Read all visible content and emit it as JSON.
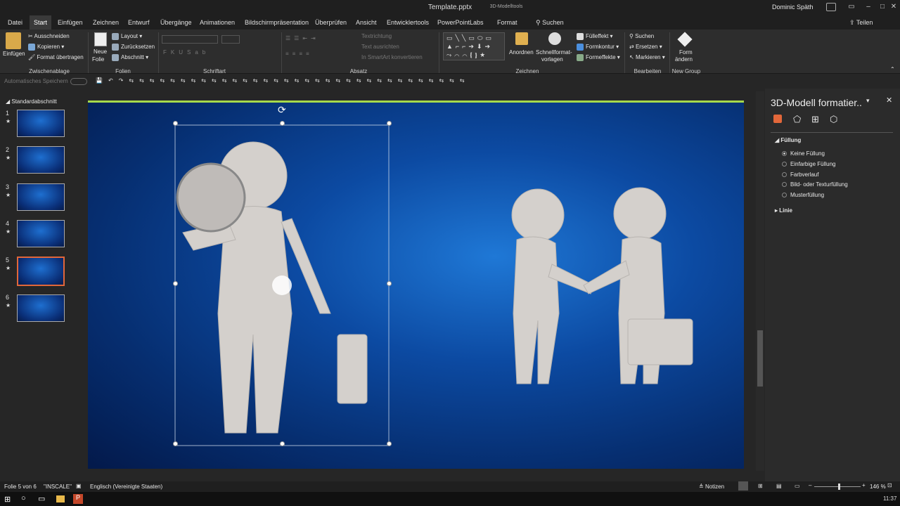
{
  "titlebar": {
    "document": "Template.pptx",
    "context_tab": "3D-Modelltools",
    "user": "Dominic Späth"
  },
  "tabs": [
    {
      "label": "Datei"
    },
    {
      "label": "Start"
    },
    {
      "label": "Einfügen"
    },
    {
      "label": "Zeichnen"
    },
    {
      "label": "Entwurf"
    },
    {
      "label": "Übergänge"
    },
    {
      "label": "Animationen"
    },
    {
      "label": "Bildschirmpräsentation"
    },
    {
      "label": "Überprüfen"
    },
    {
      "label": "Ansicht"
    },
    {
      "label": "Entwicklertools"
    },
    {
      "label": "PowerPointLabs"
    },
    {
      "label": "Format"
    }
  ],
  "search_label": "Suchen",
  "share_label": "Teilen",
  "ribbon": {
    "clipboard": {
      "paste": "Einfügen",
      "cut": "Ausschneiden",
      "copy": "Kopieren",
      "format_painter": "Format übertragen",
      "group": "Zwischenablage"
    },
    "slides": {
      "new_slide_1": "Neue",
      "new_slide_2": "Folie",
      "layout": "Layout",
      "reset": "Zurücksetzen",
      "section": "Abschnitt",
      "group": "Folien"
    },
    "font": {
      "group": "Schriftart"
    },
    "paragraph": {
      "text_direction": "Textrichtung",
      "align_text": "Text ausrichten",
      "smartart": "In SmartArt konvertieren",
      "group": "Absatz"
    },
    "drawing": {
      "arrange": "Anordnen",
      "quick_styles_1": "Schnellformat-",
      "quick_styles_2": "vorlagen",
      "fill": "Fülleffekt",
      "outline": "Formkontur",
      "effects": "Formeffekte",
      "group": "Zeichnen"
    },
    "editing": {
      "find": "Suchen",
      "replace": "Ersetzen",
      "select": "Markieren",
      "group": "Bearbeiten"
    },
    "newgroup": {
      "change_shape_1": "Form",
      "change_shape_2": "ändern",
      "group": "New Group"
    }
  },
  "autosave_label": "Automatisches Speichern",
  "thumbnails": {
    "section": "Standardabschnitt",
    "slides": [
      {
        "num": "1",
        "star": "★"
      },
      {
        "num": "2",
        "star": "★"
      },
      {
        "num": "3",
        "star": "★"
      },
      {
        "num": "4",
        "star": "★"
      },
      {
        "num": "5",
        "star": "★"
      },
      {
        "num": "6",
        "star": "★"
      }
    ]
  },
  "pane": {
    "title": "3D-Modell formatier..",
    "section_fill": "Füllung",
    "options": [
      {
        "label": "Keine Füllung",
        "selected": true
      },
      {
        "label": "Einfarbige Füllung",
        "selected": false
      },
      {
        "label": "Farbverlauf",
        "selected": false
      },
      {
        "label": "Bild- oder Texturfüllung",
        "selected": false
      },
      {
        "label": "Musterfüllung",
        "selected": false
      }
    ],
    "section_line": "Linie"
  },
  "status": {
    "slide_info": "Folie 5 von 6",
    "theme": "\"INSCALE\"",
    "language": "Englisch (Vereinigte Staaten)",
    "notes": "Notizen",
    "zoom": "146 %"
  },
  "taskbar": {
    "time": "11:37"
  },
  "colors": {
    "accent": "#a6d94b",
    "selection": "#e2673a",
    "slide_bg": "#0c4aa2"
  }
}
